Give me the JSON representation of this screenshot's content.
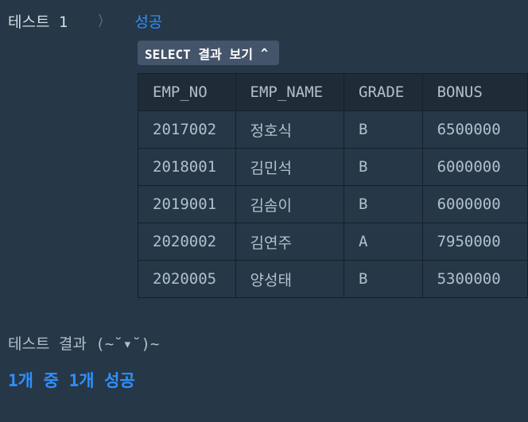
{
  "test": {
    "label": "테스트 1",
    "separator": "〉",
    "status": "성공"
  },
  "toggle": {
    "label": "SELECT 결과 보기",
    "caret": "^"
  },
  "table": {
    "columns": [
      "EMP_NO",
      "EMP_NAME",
      "GRADE",
      "BONUS"
    ],
    "rows": [
      [
        "2017002",
        "정호식",
        "B",
        "6500000"
      ],
      [
        "2018001",
        "김민석",
        "B",
        "6000000"
      ],
      [
        "2019001",
        "김솜이",
        "B",
        "6000000"
      ],
      [
        "2020002",
        "김연주",
        "A",
        "7950000"
      ],
      [
        "2020005",
        "양성태",
        "B",
        "5300000"
      ]
    ]
  },
  "result": {
    "label": "테스트 결과 (~˘▾˘)~",
    "summary": "1개 중 1개 성공"
  },
  "colors": {
    "background": "#263747",
    "success": "#2f8ffb",
    "button_bg": "#44546a",
    "header_bg": "#202b38"
  }
}
